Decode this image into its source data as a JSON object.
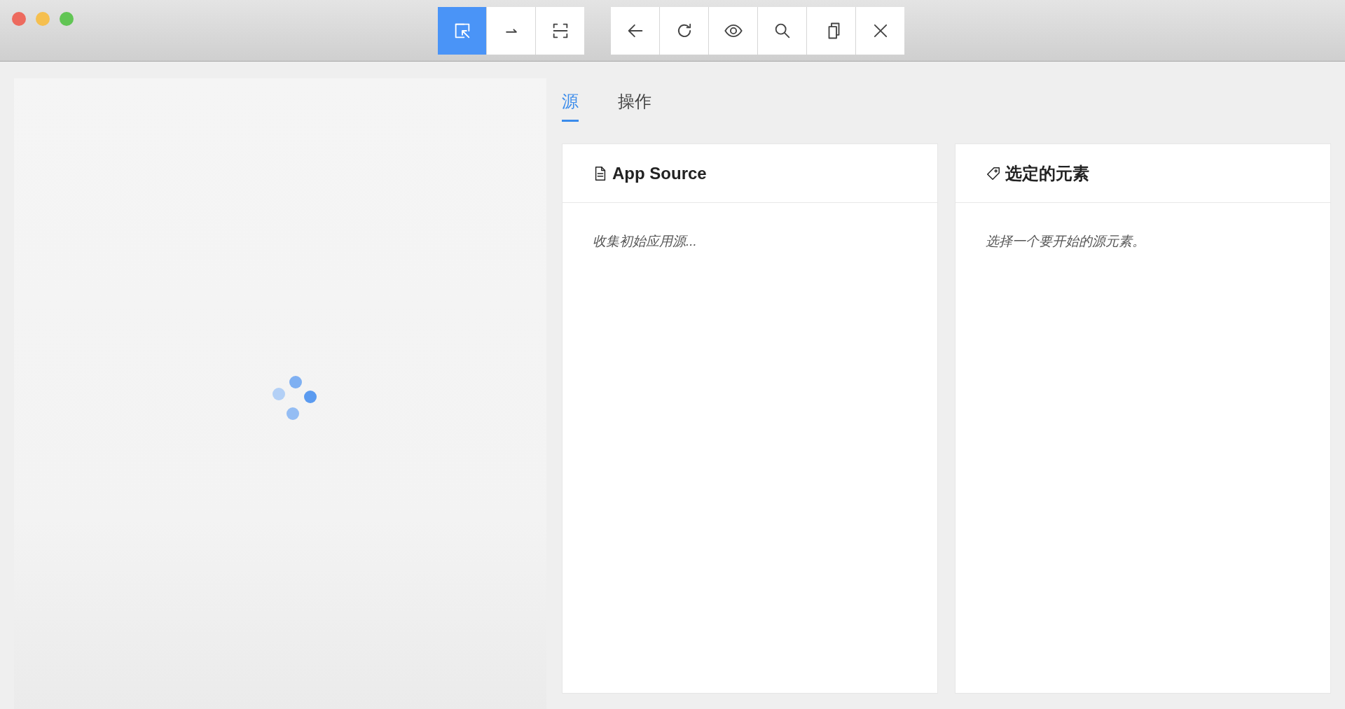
{
  "toolbar": {
    "groups": [
      [
        {
          "kind": "select",
          "selected": true
        },
        {
          "kind": "swipe",
          "selected": false
        },
        {
          "kind": "tap-area",
          "selected": false
        }
      ],
      [
        {
          "kind": "back",
          "selected": false
        },
        {
          "kind": "refresh",
          "selected": false
        },
        {
          "kind": "eye",
          "selected": false
        },
        {
          "kind": "search",
          "selected": false
        },
        {
          "kind": "copy",
          "selected": false
        },
        {
          "kind": "close",
          "selected": false
        }
      ]
    ]
  },
  "tabs": [
    {
      "label": "源",
      "selected": true
    },
    {
      "label": "操作",
      "selected": false
    }
  ],
  "panels": [
    {
      "kind": "file",
      "title": "App Source",
      "text": "收集初始应用源..."
    },
    {
      "kind": "tag",
      "title": "选定的元素",
      "text": "选择一个要开始的源元素。"
    }
  ]
}
